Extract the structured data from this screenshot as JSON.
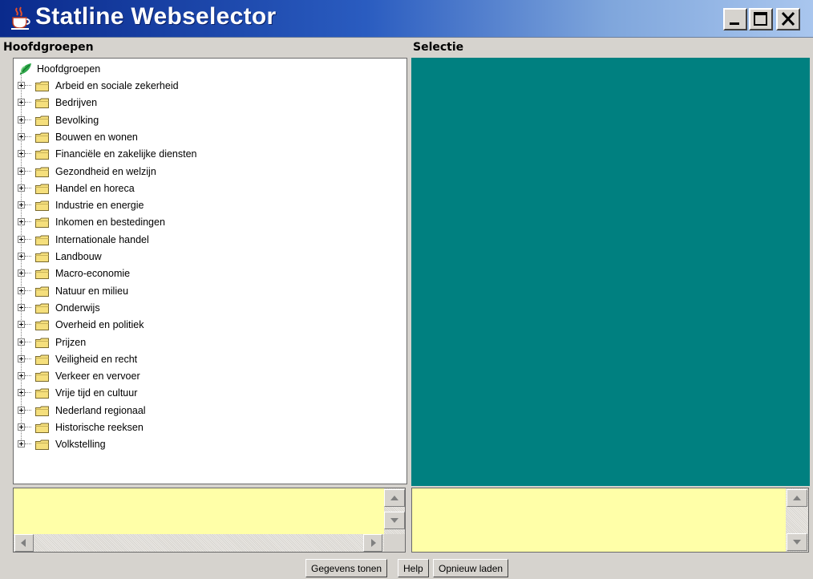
{
  "window": {
    "title": "Statline Webselector",
    "controls": [
      "minimize",
      "maximize",
      "close"
    ]
  },
  "left_pane": {
    "header": "Hoofdgroepen",
    "root_label": "Hoofdgroepen",
    "items": [
      "Arbeid en sociale zekerheid",
      "Bedrijven",
      "Bevolking",
      "Bouwen en wonen",
      "Financiële en zakelijke diensten",
      "Gezondheid en welzijn",
      "Handel en horeca",
      "Industrie en energie",
      "Inkomen en bestedingen",
      "Internationale handel",
      "Landbouw",
      "Macro-economie",
      "Natuur en milieu",
      "Onderwijs",
      "Overheid en politiek",
      "Prijzen",
      "Veiligheid en recht",
      "Verkeer en vervoer",
      "Vrije tijd en cultuur",
      "Nederland regionaal",
      "Historische reeksen",
      "Volkstelling"
    ]
  },
  "right_pane": {
    "header": "Selectie"
  },
  "buttons": {
    "show_data": "Gegevens tonen",
    "help": "Help",
    "reload": "Opnieuw laden"
  },
  "colors": {
    "title_gradient_start": "#0a2a8c",
    "selection_panel": "#008080",
    "info_panel": "#ffffa8",
    "chrome": "#d6d3ce"
  },
  "icons": {
    "app": "java-cup-icon",
    "root": "green-leaf-icon",
    "node": "folder-icon",
    "expander": "plus-expander-icon"
  }
}
